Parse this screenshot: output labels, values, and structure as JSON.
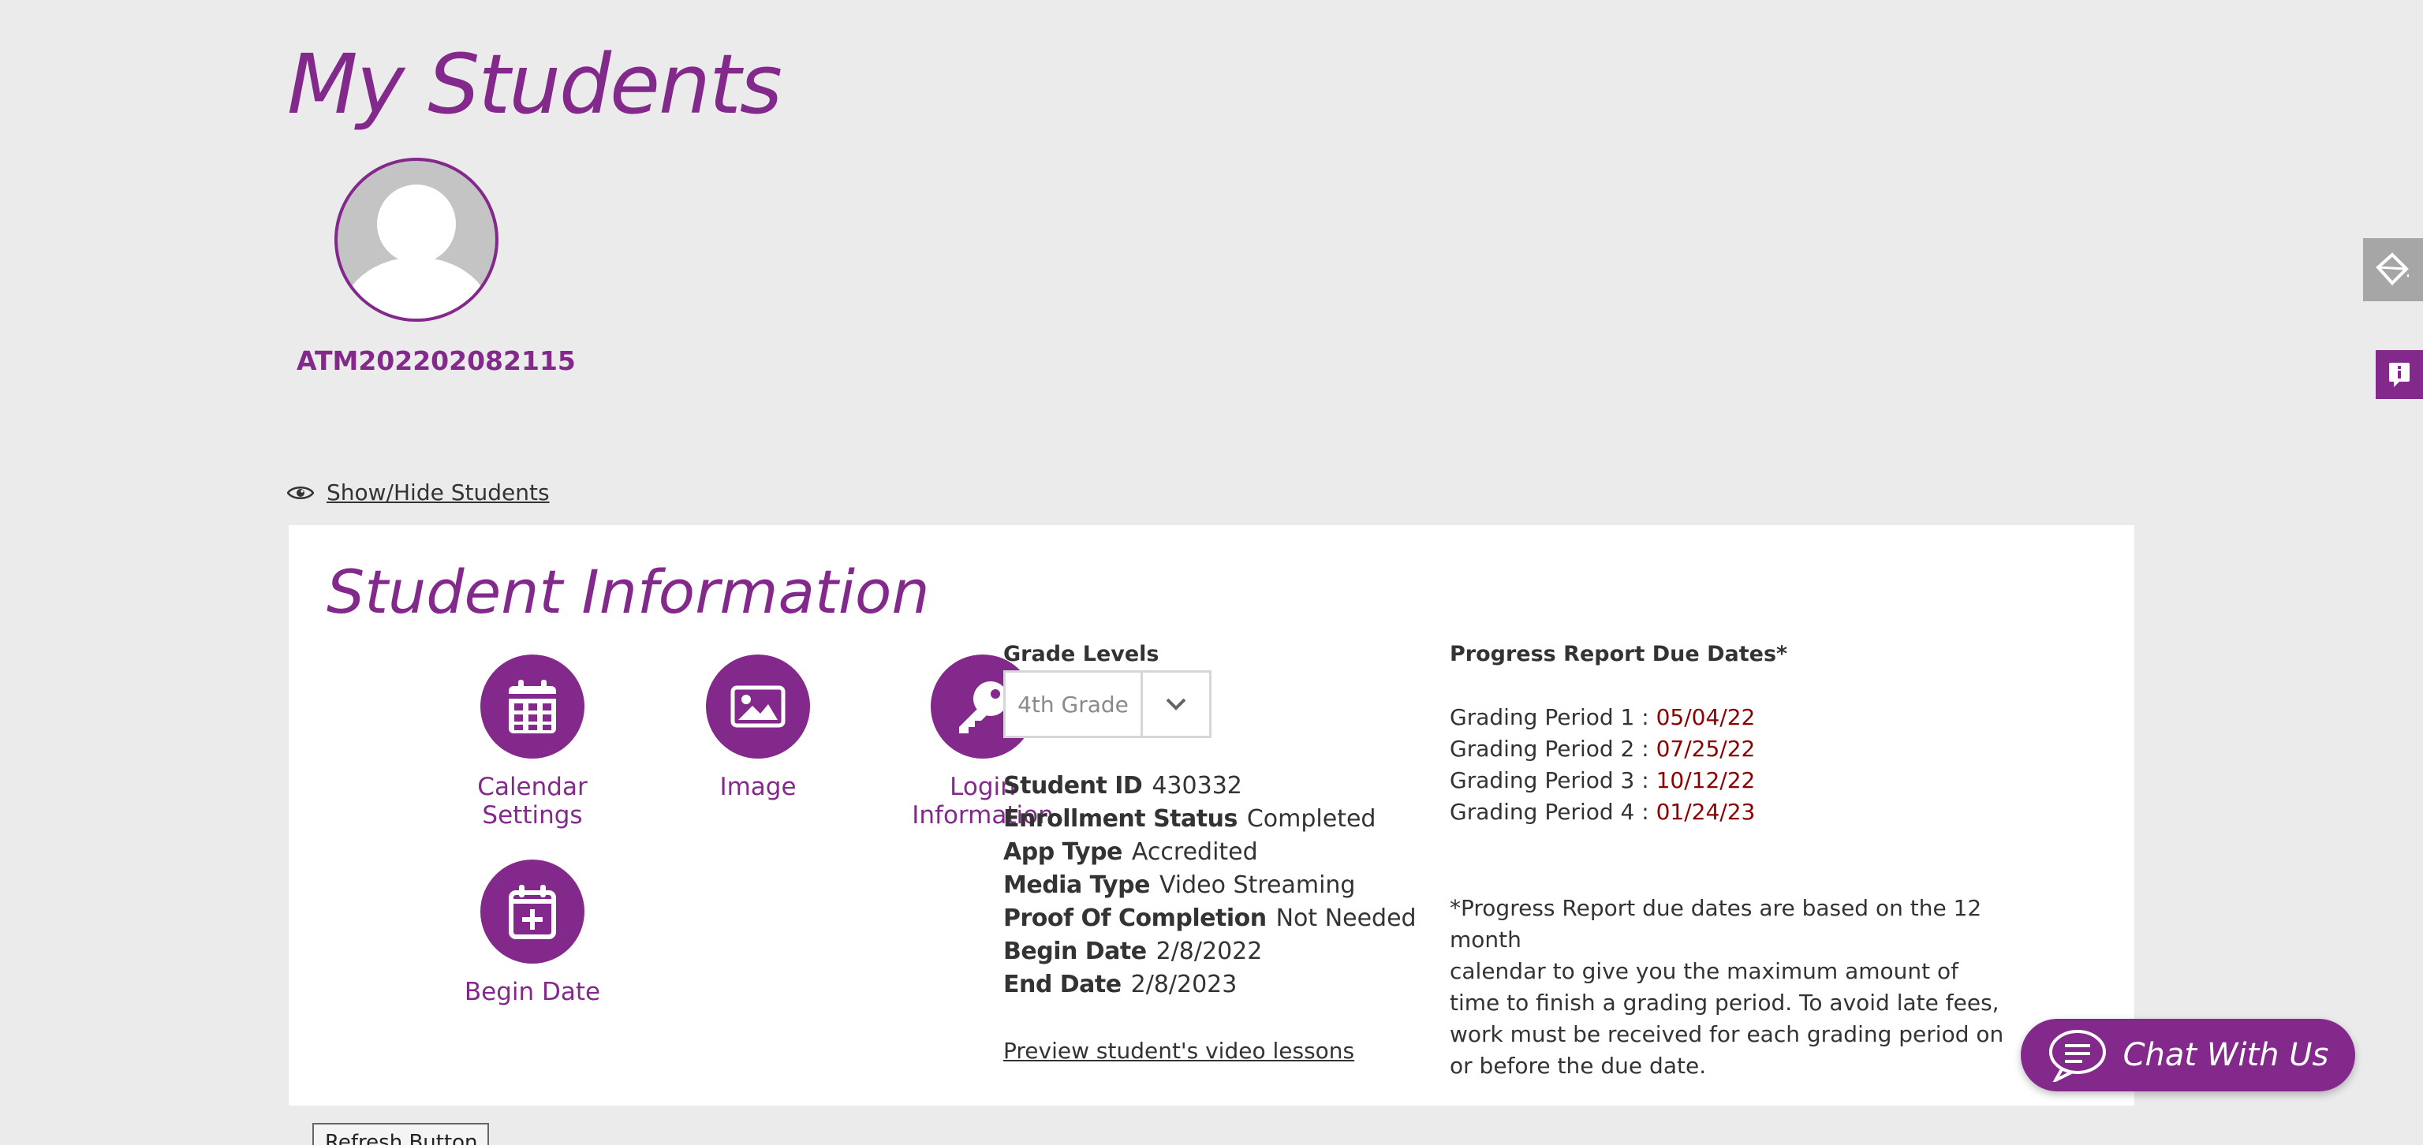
{
  "page": {
    "title": "My Students",
    "student_name": "ATM202202082115",
    "show_hide_label": "Show/Hide Students"
  },
  "student_info": {
    "title": "Student Information",
    "actions": [
      {
        "label_line1": "Calendar",
        "label_line2": "Settings",
        "icon": "calendar-icon"
      },
      {
        "label_line1": "Image",
        "label_line2": "",
        "icon": "image-icon"
      },
      {
        "label_line1": "Login",
        "label_line2": "Information",
        "icon": "key-icon"
      },
      {
        "label_line1": "Begin Date",
        "label_line2": "",
        "icon": "calendar-add-icon"
      }
    ],
    "grade_levels_label": "Grade Levels",
    "grade_selected": "4th Grade",
    "details": [
      {
        "key": "Student ID",
        "value": "430332"
      },
      {
        "key": "Enrollment Status",
        "value": "Completed"
      },
      {
        "key": "App Type",
        "value": "Accredited"
      },
      {
        "key": "Media Type",
        "value": "Video Streaming"
      },
      {
        "key": "Proof Of Completion",
        "value": "Not Needed"
      },
      {
        "key": "Begin Date",
        "value": "2/8/2022"
      },
      {
        "key": "End Date",
        "value": "2/8/2023"
      }
    ],
    "preview_link": "Preview student's video lessons",
    "progress_title": "Progress Report Due Dates*",
    "grading_periods": [
      {
        "label": "Grading Period 1 :",
        "date": "05/04/22"
      },
      {
        "label": "Grading Period 2 :",
        "date": "07/25/22"
      },
      {
        "label": "Grading Period 3 :",
        "date": "10/12/22"
      },
      {
        "label": "Grading Period 4 :",
        "date": "01/24/23"
      }
    ],
    "note_lines": [
      "*Progress Report due dates are based on the 12 month",
      "calendar to give you the maximum amount of",
      "time to finish a grading period. To avoid late fees,",
      "work must be received for each grading period on",
      "or before the due date."
    ]
  },
  "refresh_label": "Refresh Button",
  "chat_label": "Chat With Us",
  "colors": {
    "brand_purple": "#84298c",
    "due_date_red": "#8b0000",
    "background": "#ebebeb"
  }
}
